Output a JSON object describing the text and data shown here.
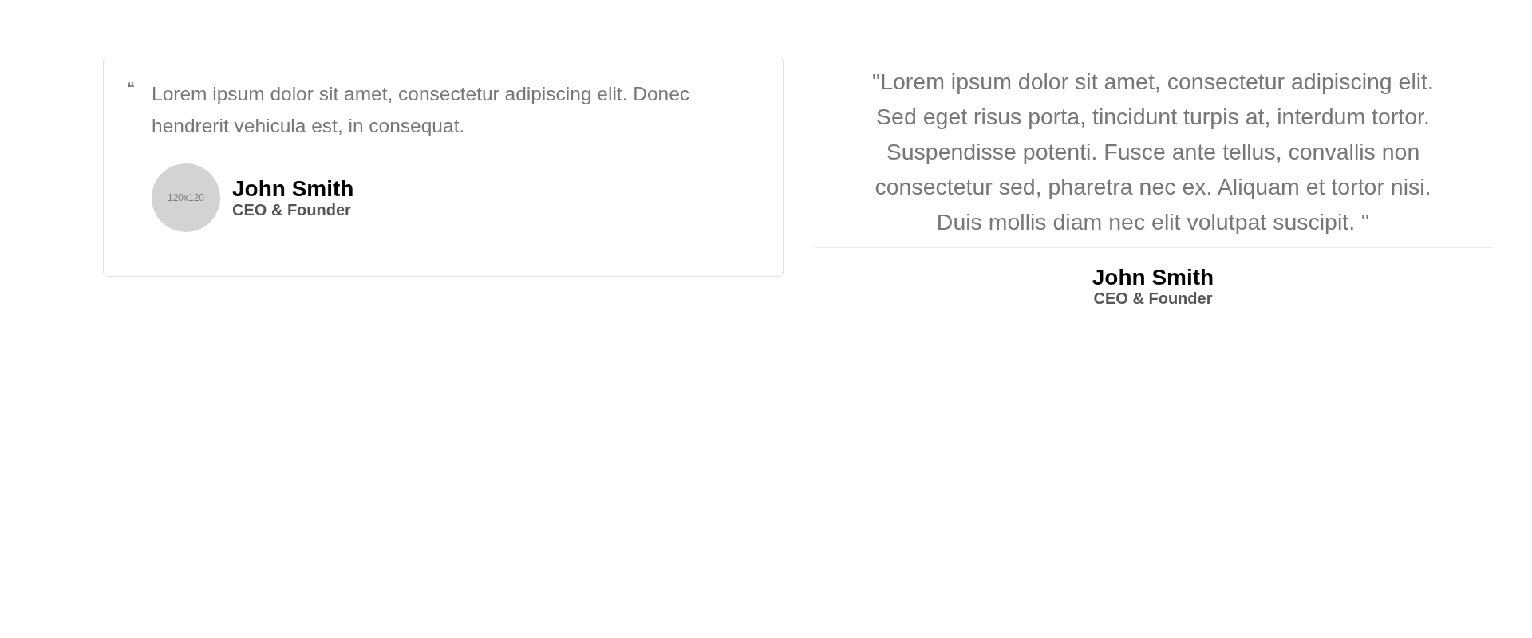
{
  "testimonials": [
    {
      "kind": "card",
      "quote_mark": "❝",
      "text": "Lorem ipsum dolor sit amet, consectetur adipiscing elit. Donec hendrerit vehicula est, in consequat.",
      "avatar_label": "120x120",
      "name": "John Smith",
      "role": "CEO & Founder"
    },
    {
      "kind": "centered",
      "text": "\"Lorem ipsum dolor sit amet, consectetur adipiscing elit. Sed eget risus porta, tincidunt turpis at, interdum tortor. Suspendisse potenti. Fusce ante tellus, convallis non consectetur sed, pharetra nec ex. Aliquam et tortor nisi. Duis mollis diam nec elit volutpat suscipit. \"",
      "name": "John Smith",
      "role": "CEO & Founder"
    }
  ]
}
